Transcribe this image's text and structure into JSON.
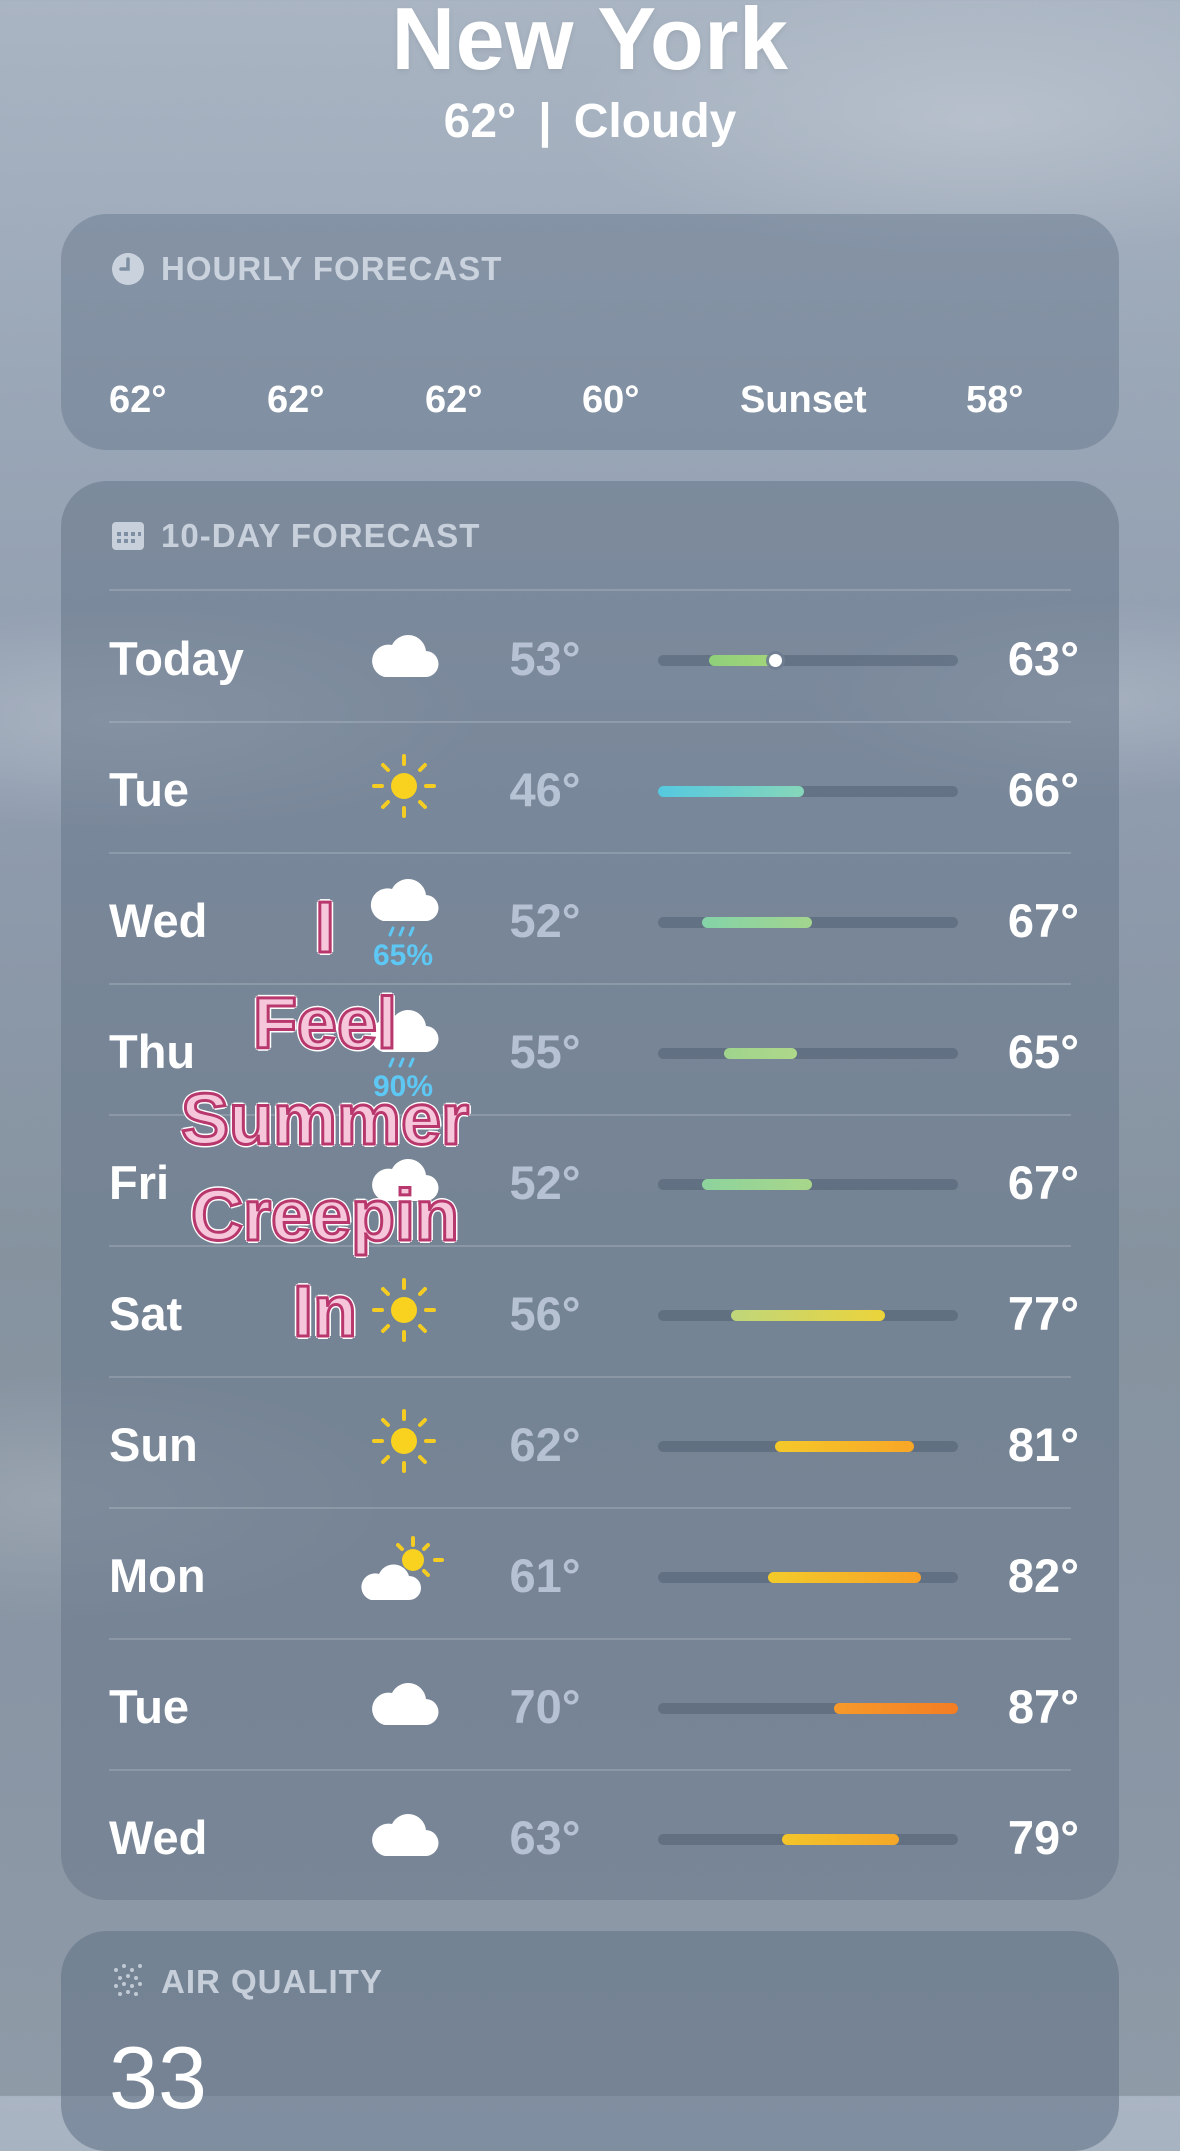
{
  "header": {
    "city": "New York",
    "temp": "62°",
    "separator": "|",
    "condition": "Cloudy"
  },
  "hourly": {
    "title": "HOURLY FORECAST",
    "icon": "clock-icon",
    "items": [
      "62°",
      "62°",
      "62°",
      "60°",
      "Sunset",
      "58°"
    ]
  },
  "ten_day": {
    "title": "10-DAY FORECAST",
    "icon": "calendar-icon",
    "range_min": 46,
    "range_max": 87,
    "days": [
      {
        "day": "Today",
        "icon": "cloud",
        "precip": "",
        "low": "53°",
        "high": "63°",
        "low_value": 53,
        "high_value": 63,
        "current": 62,
        "colors": [
          "#8fd07a",
          "#a5d57a"
        ]
      },
      {
        "day": "Tue",
        "icon": "sun",
        "precip": "",
        "low": "46°",
        "high": "66°",
        "low_value": 46,
        "high_value": 66,
        "colors": [
          "#55c9e0",
          "#86d6b9"
        ]
      },
      {
        "day": "Wed",
        "icon": "rain-cloud",
        "precip": "65%",
        "low": "52°",
        "high": "67°",
        "low_value": 52,
        "high_value": 67,
        "colors": [
          "#84d3a8",
          "#a3d58e"
        ]
      },
      {
        "day": "Thu",
        "icon": "rain-cloud",
        "precip": "90%",
        "low": "55°",
        "high": "65°",
        "low_value": 55,
        "high_value": 65,
        "colors": [
          "#9fd48c",
          "#aed88a"
        ]
      },
      {
        "day": "Fri",
        "icon": "cloud",
        "precip": "",
        "low": "52°",
        "high": "67°",
        "low_value": 52,
        "high_value": 67,
        "colors": [
          "#8dd39d",
          "#a8d68a"
        ]
      },
      {
        "day": "Sat",
        "icon": "sun",
        "precip": "",
        "low": "56°",
        "high": "77°",
        "low_value": 56,
        "high_value": 77,
        "colors": [
          "#bfd67b",
          "#ecd43a"
        ]
      },
      {
        "day": "Sun",
        "icon": "sun",
        "precip": "",
        "low": "62°",
        "high": "81°",
        "low_value": 62,
        "high_value": 81,
        "colors": [
          "#f5c92a",
          "#f8a626"
        ]
      },
      {
        "day": "Mon",
        "icon": "sun-cloud",
        "precip": "",
        "low": "61°",
        "high": "82°",
        "low_value": 61,
        "high_value": 82,
        "colors": [
          "#f3cb2a",
          "#f7a126"
        ]
      },
      {
        "day": "Tue",
        "icon": "cloud",
        "precip": "",
        "low": "70°",
        "high": "87°",
        "low_value": 70,
        "high_value": 87,
        "colors": [
          "#f79a2a",
          "#f47d24"
        ]
      },
      {
        "day": "Wed",
        "icon": "cloud",
        "precip": "",
        "low": "63°",
        "high": "79°",
        "low_value": 63,
        "high_value": 79,
        "colors": [
          "#f4c52a",
          "#f5a728"
        ]
      }
    ]
  },
  "air_quality": {
    "title": "AIR QUALITY",
    "icon": "air-quality-icon",
    "value": "33"
  },
  "sticker": {
    "lines": [
      "I",
      "Feel",
      "Summer",
      "Creepin",
      "In"
    ]
  }
}
